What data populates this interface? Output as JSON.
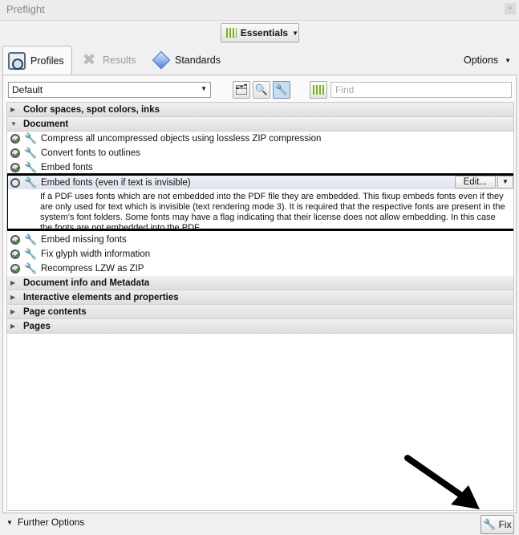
{
  "window": {
    "title": "Preflight",
    "close_glyph": "▫"
  },
  "workspace": {
    "label": "Essentials"
  },
  "tabs": [
    {
      "label": "Profiles",
      "icon": "profiles-icon",
      "active": true
    },
    {
      "label": "Results",
      "icon": "results-icon",
      "disabled": true
    },
    {
      "label": "Standards",
      "icon": "standards-icon"
    }
  ],
  "options_label": "Options",
  "toolbar": {
    "profile_value": "Default",
    "find_placeholder": "Find"
  },
  "list": {
    "rows": [
      {
        "type": "group",
        "label": "Color spaces, spot colors, inks",
        "expanded": false
      },
      {
        "type": "group",
        "label": "Document",
        "expanded": true
      },
      {
        "type": "item",
        "label": "Compress all uncompressed objects using lossless ZIP compression"
      },
      {
        "type": "item",
        "label": "Convert fonts to outlines"
      },
      {
        "type": "item",
        "label": "Embed fonts"
      }
    ],
    "selected": {
      "label": "Embed fonts (even if text is invisible)",
      "edit_label": "Edit...",
      "description": "If a PDF uses fonts which are not embedded into the PDF file they are embedded. This fixup embeds fonts even if they are only used for text which is invisible (text rendering mode 3). It is required that the respective fonts are present in the system's font folders. Some fonts may have a flag indicating that their license does not allow embedding. In this case the fonts are not embedded into the PDF."
    },
    "rows_after": [
      {
        "type": "item",
        "label": "Embed missing fonts"
      },
      {
        "type": "item",
        "label": "Fix glyph width information"
      },
      {
        "type": "item",
        "label": "Recompress LZW as ZIP"
      },
      {
        "type": "group",
        "label": "Document info and Metadata",
        "expanded": false
      },
      {
        "type": "group",
        "label": "Interactive elements and properties",
        "expanded": false
      },
      {
        "type": "group",
        "label": "Page contents",
        "expanded": false
      },
      {
        "type": "group",
        "label": "Pages",
        "expanded": false
      }
    ]
  },
  "footer": {
    "further_options": "Further Options",
    "fix_label": "Fix"
  }
}
